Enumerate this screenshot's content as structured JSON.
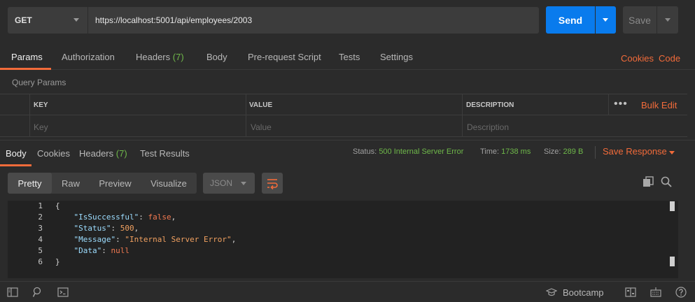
{
  "request": {
    "method": "GET",
    "url": "https://localhost:5001/api/employees/2003",
    "send_label": "Send",
    "save_label": "Save"
  },
  "request_tabs": [
    {
      "label": "Params"
    },
    {
      "label": "Authorization"
    },
    {
      "label": "Headers",
      "count": "(7)"
    },
    {
      "label": "Body"
    },
    {
      "label": "Pre-request Script"
    },
    {
      "label": "Tests"
    },
    {
      "label": "Settings"
    }
  ],
  "request_links": {
    "cookies": "Cookies",
    "code": "Code"
  },
  "query_params": {
    "title": "Query Params",
    "headers": {
      "key": "KEY",
      "value": "VALUE",
      "description": "DESCRIPTION"
    },
    "placeholders": {
      "key": "Key",
      "value": "Value",
      "description": "Description"
    },
    "bulk_edit": "Bulk Edit",
    "more": "•••"
  },
  "response_tabs": [
    {
      "label": "Body"
    },
    {
      "label": "Cookies"
    },
    {
      "label": "Headers",
      "count": "(7)"
    },
    {
      "label": "Test Results"
    }
  ],
  "response_meta": {
    "status_label": "Status:",
    "status_value": "500 Internal Server Error",
    "time_label": "Time:",
    "time_value": "1738 ms",
    "size_label": "Size:",
    "size_value": "289 B",
    "save_response": "Save Response"
  },
  "view_tabs": [
    "Pretty",
    "Raw",
    "Preview",
    "Visualize"
  ],
  "format": "JSON",
  "code_lines": [
    {
      "num": "1"
    },
    {
      "num": "2",
      "key": "\"IsSuccessful\"",
      "value": "false",
      "trail": ","
    },
    {
      "num": "3",
      "key": "\"Status\"",
      "value": "500",
      "trail": ","
    },
    {
      "num": "4",
      "key": "\"Message\"",
      "value": "\"Internal Server Error\"",
      "trail": ","
    },
    {
      "num": "5",
      "key": "\"Data\"",
      "value": "null",
      "trail": ""
    },
    {
      "num": "6"
    }
  ],
  "code_braces": {
    "open": "{",
    "close": "}"
  },
  "statusbar": {
    "bootcamp": "Bootcamp"
  },
  "colors": {
    "accent": "#f26b3a",
    "send": "#097bed",
    "success_text": "#6fb84a"
  }
}
